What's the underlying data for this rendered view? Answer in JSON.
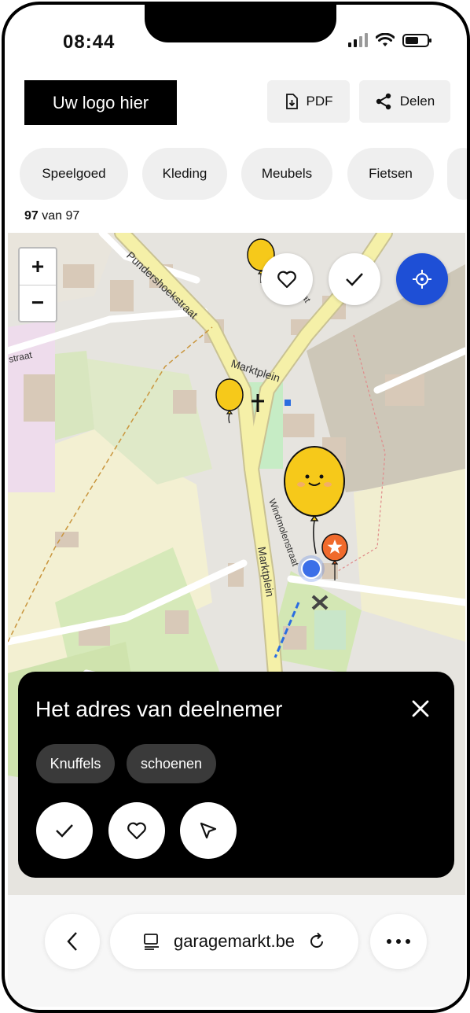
{
  "status": {
    "time": "08:44"
  },
  "header": {
    "logo_label": "Uw logo hier",
    "pdf_label": "PDF",
    "share_label": "Delen"
  },
  "categories": [
    "Speelgoed",
    "Kleding",
    "Meubels",
    "Fietsen"
  ],
  "results": {
    "shown": "97",
    "separator": " van ",
    "total": "97"
  },
  "map": {
    "zoom_in_label": "+",
    "zoom_out_label": "−",
    "street_labels": {
      "pundershoek": "Pundershoekstraat",
      "markt1": "Marktplein",
      "markt2": "Marktplein",
      "windmolen": "Windmolenstraat",
      "straat_left": "straat",
      "raat": "raat"
    }
  },
  "card": {
    "title": "Het adres van deelnemer",
    "tags": [
      "Knuffels",
      "schoenen"
    ]
  },
  "browser": {
    "url": "garagemarkt.be"
  },
  "colors": {
    "accent_blue": "#1e4fd6",
    "balloon_yellow": "#f6c91a",
    "balloon_orange": "#f06a2c",
    "road_yellow": "#f5f0a8"
  }
}
